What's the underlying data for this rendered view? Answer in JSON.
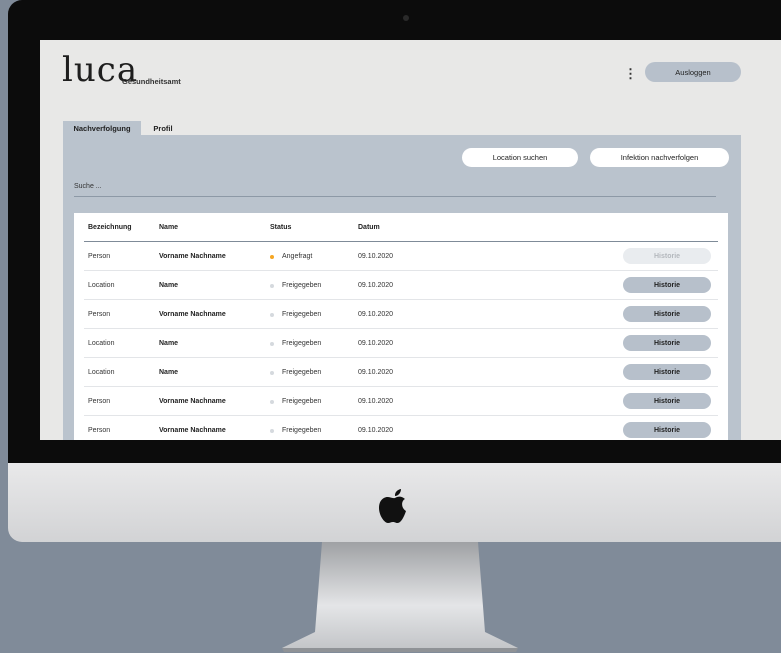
{
  "app": {
    "logo": "luca",
    "subtitle": "Gesundheitsamt",
    "menu_icon": "vertical-dots-icon",
    "logout_label": "Ausloggen"
  },
  "tabs": [
    {
      "label": "Nachverfolgung",
      "active": true
    },
    {
      "label": "Profil",
      "active": false
    }
  ],
  "actions": {
    "location_search": "Location suchen",
    "trace_infection": "Infektion nachverfolgen"
  },
  "search": {
    "placeholder": "Suche ..."
  },
  "table": {
    "headers": [
      "Bezeichnung",
      "Name",
      "Status",
      "Datum"
    ],
    "rows": [
      {
        "type": "Person",
        "name": "Vorname Nachname",
        "status": "Angefragt",
        "status_color": "#f5a623",
        "date": "09.10.2020",
        "history": "Historie",
        "history_enabled": false
      },
      {
        "type": "Location",
        "name": "Name",
        "status": "Freigegeben",
        "status_color": "#d5d9de",
        "date": "09.10.2020",
        "history": "Historie",
        "history_enabled": true
      },
      {
        "type": "Person",
        "name": "Vorname Nachname",
        "status": "Freigegeben",
        "status_color": "#d5d9de",
        "date": "09.10.2020",
        "history": "Historie",
        "history_enabled": true
      },
      {
        "type": "Location",
        "name": "Name",
        "status": "Freigegeben",
        "status_color": "#d5d9de",
        "date": "09.10.2020",
        "history": "Historie",
        "history_enabled": true
      },
      {
        "type": "Location",
        "name": "Name",
        "status": "Freigegeben",
        "status_color": "#d5d9de",
        "date": "09.10.2020",
        "history": "Historie",
        "history_enabled": true
      },
      {
        "type": "Person",
        "name": "Vorname Nachname",
        "status": "Freigegeben",
        "status_color": "#d5d9de",
        "date": "09.10.2020",
        "history": "Historie",
        "history_enabled": true
      },
      {
        "type": "Person",
        "name": "Vorname Nachname",
        "status": "Freigegeben",
        "status_color": "#d5d9de",
        "date": "09.10.2020",
        "history": "Historie",
        "history_enabled": true
      }
    ]
  },
  "colors": {
    "panel": "#bac3cd",
    "button_secondary": "#b7c0cb",
    "status_pending": "#f5a623"
  },
  "device_icon": "apple-logo-icon"
}
